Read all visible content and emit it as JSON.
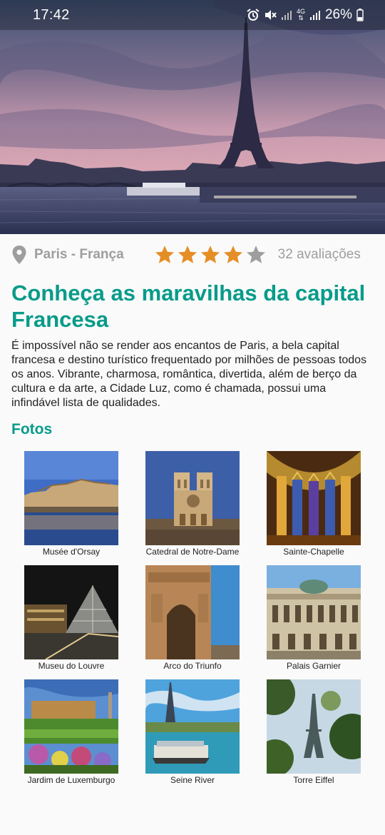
{
  "status_bar": {
    "time": "17:42",
    "network": "4G",
    "battery": "26%",
    "icons": [
      "alarm-icon",
      "mute-icon",
      "signal-icon",
      "signal-icon",
      "battery-icon"
    ]
  },
  "hero": {
    "image": "eiffel-tower-sunset-photo"
  },
  "place": {
    "location": "Paris - França",
    "rating": 4,
    "rating_max": 5,
    "reviews": "32 avaliações"
  },
  "article": {
    "title": "Conheça as maravilhas da capital Francesa",
    "description": "É impossível não se render aos encantos de Paris, a bela capital francesa e destino turístico frequentado por milhões de pessoas todos os anos. Vibrante, charmosa, romântica, divertida, além de berço da cultura e da arte, a Cidade Luz, como é chamada, possui uma infindável lista de qualidades."
  },
  "photos": {
    "heading": "Fotos",
    "items": [
      {
        "caption": "Musée d'Orsay"
      },
      {
        "caption": "Catedral de Notre-Dame"
      },
      {
        "caption": "Sainte-Chapelle"
      },
      {
        "caption": "Museu do Louvre"
      },
      {
        "caption": "Arco do Triunfo"
      },
      {
        "caption": "Palais Garnier"
      },
      {
        "caption": "Jardim de Luxemburgo"
      },
      {
        "caption": "Seine River"
      },
      {
        "caption": "Torre Eiffel"
      }
    ]
  },
  "colors": {
    "accent": "#089b8a",
    "star": "#e58e26",
    "star_empty": "#9e9e9e",
    "muted_text": "#9e9e9e"
  }
}
